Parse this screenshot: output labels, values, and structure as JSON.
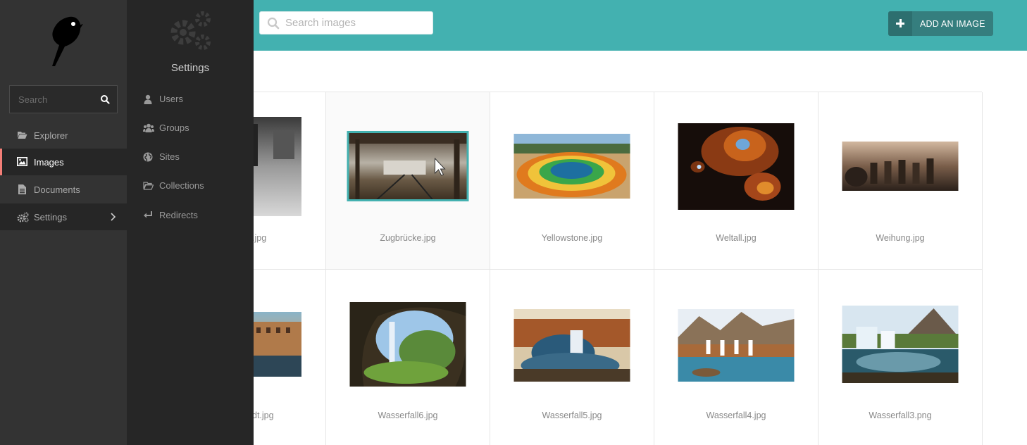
{
  "header": {
    "search_placeholder": "Search images",
    "add_button_label": "ADD AN IMAGE"
  },
  "sidebar": {
    "search_placeholder": "Search",
    "items": [
      {
        "label": "Explorer",
        "icon": "folder-open-icon"
      },
      {
        "label": "Images",
        "icon": "image-icon",
        "active": true
      },
      {
        "label": "Documents",
        "icon": "document-icon"
      },
      {
        "label": "Settings",
        "icon": "cogs-icon",
        "expanded": true
      }
    ]
  },
  "submenu": {
    "title": "Settings",
    "items": [
      {
        "label": "Users",
        "icon": "user-icon"
      },
      {
        "label": "Groups",
        "icon": "group-icon"
      },
      {
        "label": "Sites",
        "icon": "globe-icon"
      },
      {
        "label": "Collections",
        "icon": "folder-open-icon"
      },
      {
        "label": "Redirects",
        "icon": "redirect-icon"
      }
    ]
  },
  "images": [
    {
      "caption": ".jpg"
    },
    {
      "caption": "Zugbrücke.jpg"
    },
    {
      "caption": "Yellowstone.jpg"
    },
    {
      "caption": "Weltall.jpg"
    },
    {
      "caption": "Weihung.jpg"
    },
    {
      "caption": "dt.jpg"
    },
    {
      "caption": "Wasserfall6.jpg"
    },
    {
      "caption": "Wasserfall5.jpg"
    },
    {
      "caption": "Wasserfall4.jpg"
    },
    {
      "caption": "Wasserfall3.png"
    }
  ],
  "colors": {
    "header_teal": "#43b1b0",
    "button_dark_teal": "#357e7e",
    "active_indicator": "#f37e77",
    "sidebar_bg": "#333333",
    "submenu_bg": "#262626"
  }
}
